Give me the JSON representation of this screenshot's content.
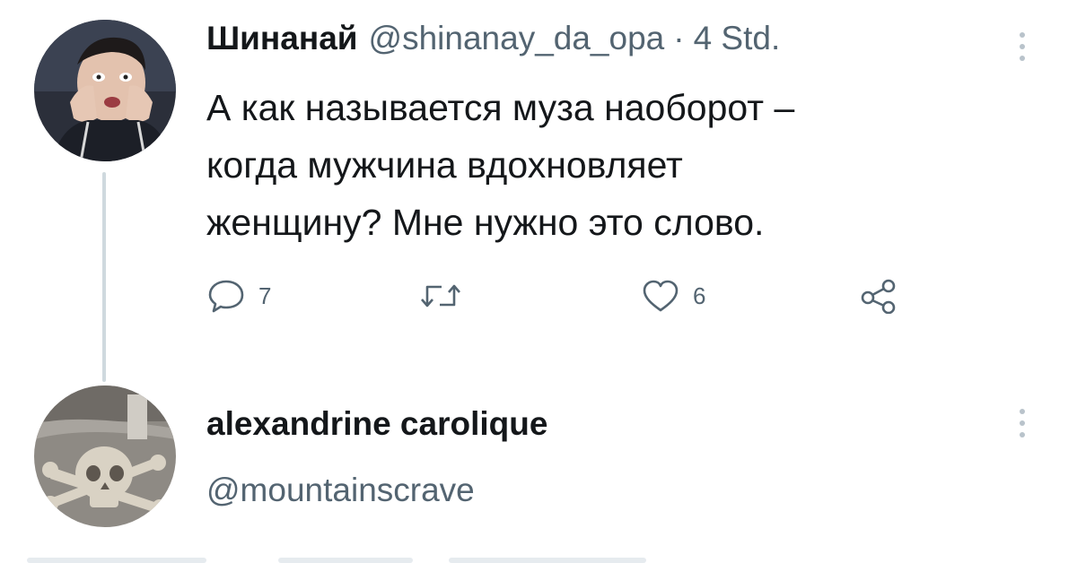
{
  "tweet": {
    "author_name": "Шинанай",
    "author_handle": "@shinanay_da_opa",
    "separator": "·",
    "time": "4 Std.",
    "text_lines": [
      "А как называется муза наоборот –",
      "когда мужчина вдохновляет",
      "женщину? Мне нужно это слово."
    ],
    "actions": {
      "reply_count": "7",
      "retweet_count": "",
      "like_count": "6"
    },
    "avatar_icon": "child-photo-avatar"
  },
  "reply": {
    "author_name": "alexandrine carolique",
    "author_handle": "@mountainscrave",
    "avatar_icon": "skull-crossbones-avatar"
  },
  "colors": {
    "text": "#14171a",
    "secondary": "#536471",
    "thread_line": "#cfd9de"
  }
}
